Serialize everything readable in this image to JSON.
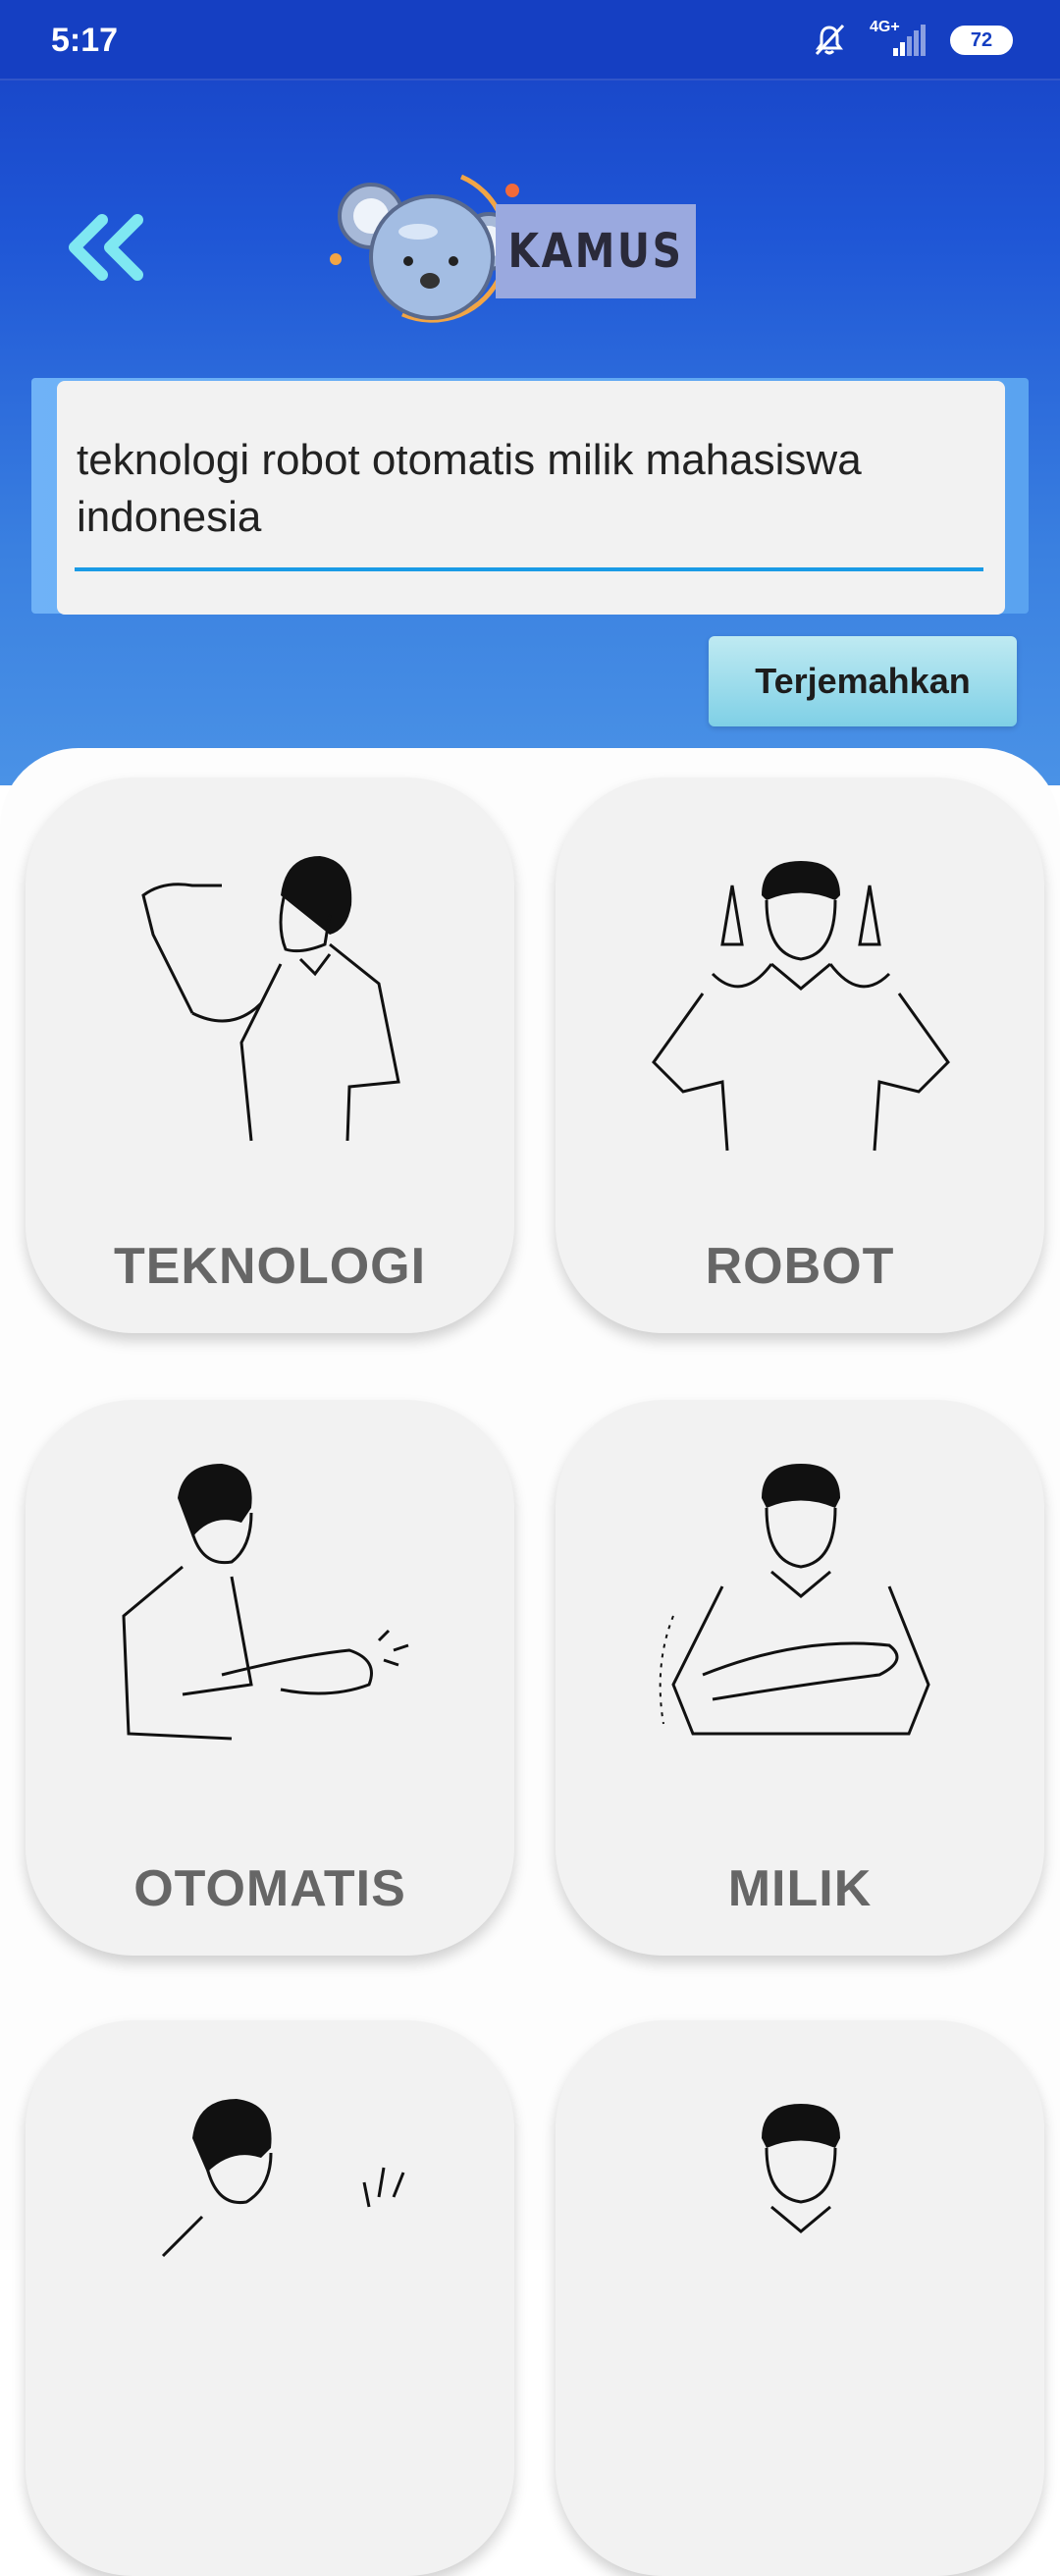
{
  "status_bar": {
    "time": "5:17",
    "network": "4G+",
    "battery": "72"
  },
  "header": {
    "title": "KAMUS"
  },
  "input": {
    "value": "teknologi robot otomatis milik mahasiswa indonesia"
  },
  "translate_button": {
    "label": "Terjemahkan"
  },
  "cards": [
    {
      "label": "TEKNOLOGI"
    },
    {
      "label": "ROBOT"
    },
    {
      "label": "OTOMATIS"
    },
    {
      "label": "MILIK"
    },
    {
      "label": ""
    },
    {
      "label": ""
    }
  ],
  "colors": {
    "header_blue": "#1741c4",
    "accent_line": "#1a9be6",
    "button": "#7fd0e6"
  }
}
